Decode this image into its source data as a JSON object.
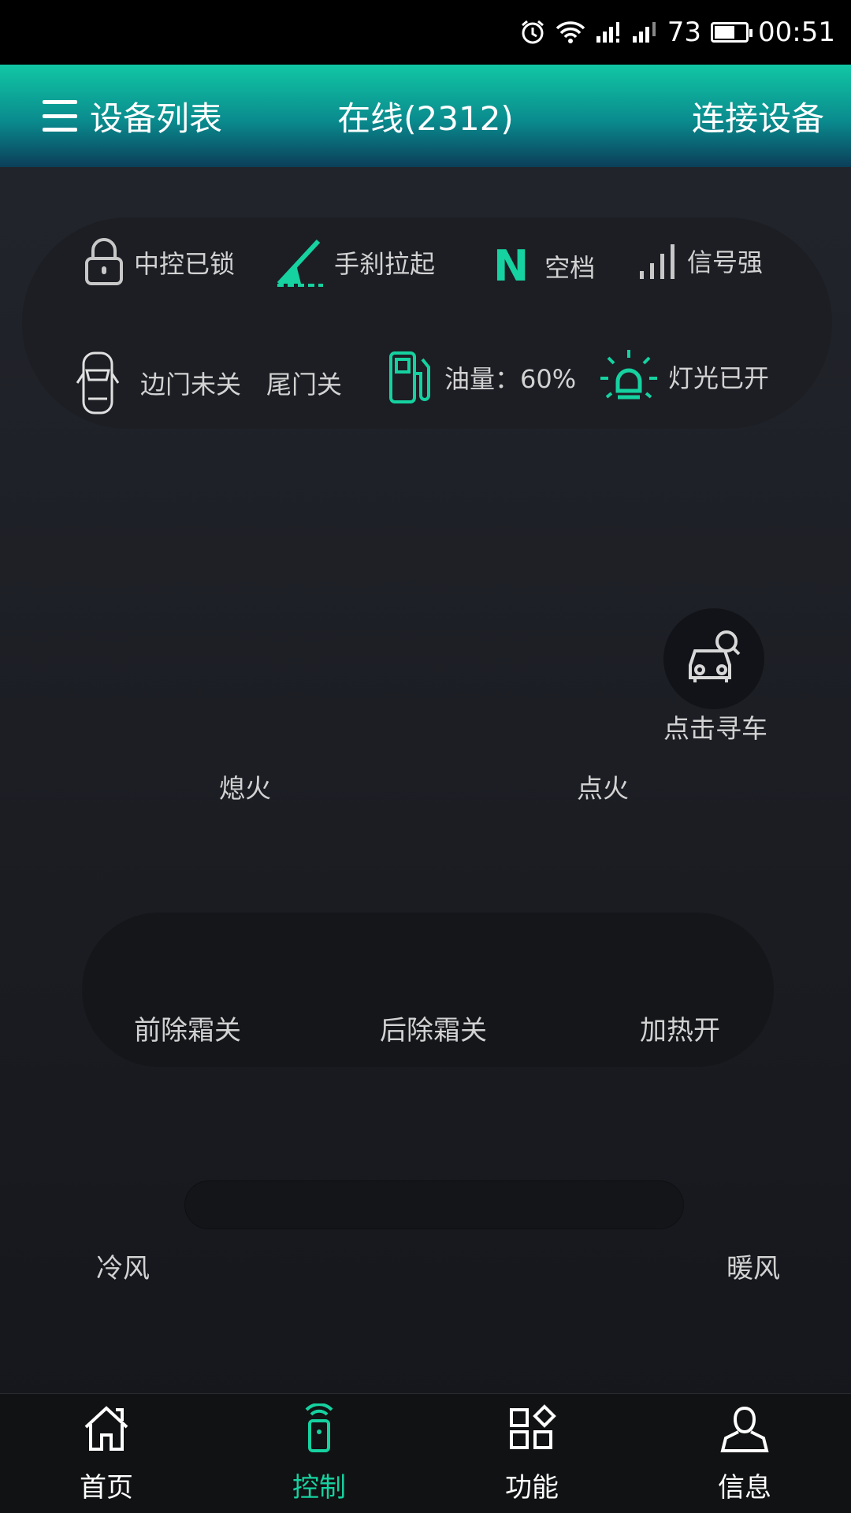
{
  "status_bar": {
    "battery": "73",
    "time": "00:51"
  },
  "app_bar": {
    "left_label": "设备列表",
    "center_label": "在线(2312)",
    "right_label": "连接设备"
  },
  "status": {
    "lock": "中控已锁",
    "handbrake": "手刹拉起",
    "gear_letter": "N",
    "gear": "空档",
    "signal": "信号强",
    "side_door": "边门未关",
    "tail_door": "尾门关",
    "fuel": "油量：60%",
    "lights": "灯光已开"
  },
  "find_car": {
    "label": "点击寻车"
  },
  "engine": {
    "off_label": "熄火",
    "on_label": "点火"
  },
  "climate": {
    "front_defrost": "前除霜关",
    "rear_defrost": "后除霜关",
    "heating": "加热开"
  },
  "wind": {
    "cold": "冷风",
    "warm": "暖风"
  },
  "bottom_nav": [
    {
      "label": "首页",
      "icon": "home-icon"
    },
    {
      "label": "控制",
      "icon": "remote-icon"
    },
    {
      "label": "功能",
      "icon": "grid-icon"
    },
    {
      "label": "信息",
      "icon": "user-icon"
    }
  ],
  "colors": {
    "accent": "#16d1a0",
    "appbar_top": "#11c7a4",
    "appbar_bottom": "#0b3e59",
    "background": "#1f2127"
  }
}
